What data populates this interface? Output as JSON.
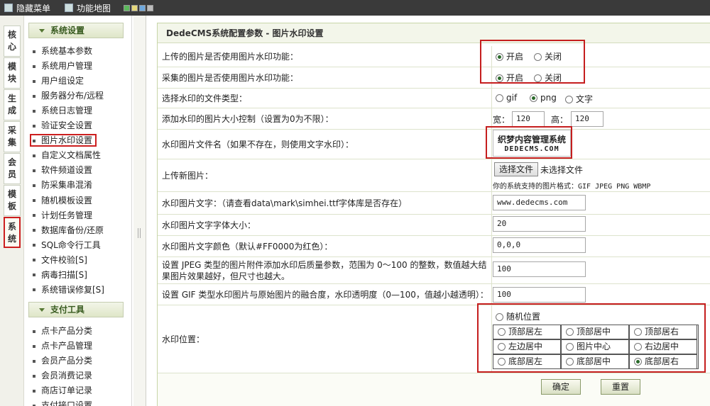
{
  "topbar": {
    "hide_menu": "隐藏菜单",
    "site_map": "功能地图",
    "skin_colors": [
      "#5cb85c",
      "#e5d77a",
      "#6fa8dc",
      "#bbbbbb"
    ]
  },
  "vtabs": [
    "核心",
    "模块",
    "生成",
    "采集",
    "会员",
    "模板",
    "系统"
  ],
  "menu": {
    "section1_title": "系统设置",
    "section1_items": [
      "系统基本参数",
      "系统用户管理",
      "用户组设定",
      "服务器分布/远程",
      "系统日志管理",
      "验证安全设置",
      "图片水印设置",
      "自定义文档属性",
      "软件频道设置",
      "防采集串混淆",
      "随机模板设置",
      "计划任务管理",
      "数据库备份/还原",
      "SQL命令行工具",
      "文件校验[S]",
      "病毒扫描[S]",
      "系统错误修复[S]"
    ],
    "section2_title": "支付工具",
    "section2_items": [
      "点卡产品分类",
      "点卡产品管理",
      "会员产品分类",
      "会员消费记录",
      "商店订单记录",
      "支付接口设置"
    ]
  },
  "main": {
    "title": "DedeCMS系统配置参数 - 图片水印设置",
    "rows": {
      "upload_wm_label": "上传的图片是否使用图片水印功能：",
      "collect_wm_label": "采集的图片是否使用图片水印功能：",
      "filetype_label": "选择水印的文件类型：",
      "size_label": "添加水印的图片大小控制（设置为0为不限）：",
      "wmfile_label": "水印图片文件名（如果不存在，则使用文字水印）：",
      "upload_label": "上传新图片：",
      "wmtext_label": "水印图片文字：（请查看data\\mark\\simhei.ttf字体库是否存在）",
      "fontsize_label": "水印图片文字字体大小：",
      "fontcolor_label": "水印图片文字颜色（默认#FF0000为红色）：",
      "jpeg_quality_label": "设置 JPEG 类型的图片附件添加水印后质量参数，范围为 0～100 的整数，数值越大结果图片效果越好，但尺寸也越大。",
      "gif_alpha_label": "设置 GIF 类型水印图片与原始图片的融合度，水印透明度（0—100，值越小越透明）：",
      "position_label": "水印位置："
    },
    "options": {
      "on": "开启",
      "off": "关闭",
      "gif": "gif",
      "png": "png",
      "text": "文字"
    },
    "size": {
      "width_label": "宽：",
      "width": "120",
      "height_label": "高：",
      "height": "120"
    },
    "wm_image_line1": "织梦内容管理系统",
    "wm_image_line2": "DEDECMS.COM",
    "upload": {
      "button": "选择文件",
      "no_file": "未选择文件",
      "formats": "你的系统支持的图片格式：GIF JPEG PNG WBMP"
    },
    "values": {
      "wm_text": "www.dedecms.com",
      "font_size": "20",
      "font_color": "0,0,0",
      "jpeg_quality": "100",
      "gif_alpha": "100"
    },
    "position": {
      "random": "随机位置",
      "cells": [
        "顶部居左",
        "顶部居中",
        "顶部居右",
        "左边居中",
        "图片中心",
        "右边居中",
        "底部居左",
        "底部居中",
        "底部居右"
      ],
      "selected": "底部居右"
    },
    "buttons": {
      "ok": "确定",
      "reset": "重置"
    }
  }
}
